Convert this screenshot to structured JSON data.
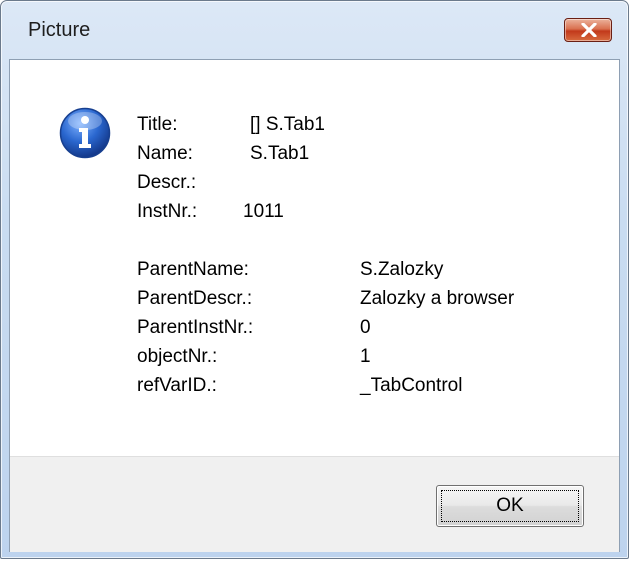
{
  "window": {
    "title": "Picture",
    "close_icon": "close-icon"
  },
  "message": {
    "icon": "info-icon",
    "rows1": [
      {
        "label": "Title:",
        "value": "[] S.Tab1"
      },
      {
        "label": "Name:",
        "value": "S.Tab1"
      },
      {
        "label": "Descr.:",
        "value": ""
      },
      {
        "label": "InstNr.:",
        "value": "1011"
      }
    ],
    "rows2": [
      {
        "label": "ParentName:",
        "value": "S.Zalozky"
      },
      {
        "label": "ParentDescr.:",
        "value": "Zalozky a browser"
      },
      {
        "label": "ParentInstNr.:",
        "value": "0"
      },
      {
        "label": "objectNr.:",
        "value": "1"
      },
      {
        "label": "refVarID.:",
        "value": "_TabControl"
      }
    ]
  },
  "buttons": {
    "ok_label": "OK"
  },
  "colors": {
    "titlebar": "#c9dcf1",
    "close_button": "#c2391b",
    "info_icon": "#1c55b5"
  }
}
